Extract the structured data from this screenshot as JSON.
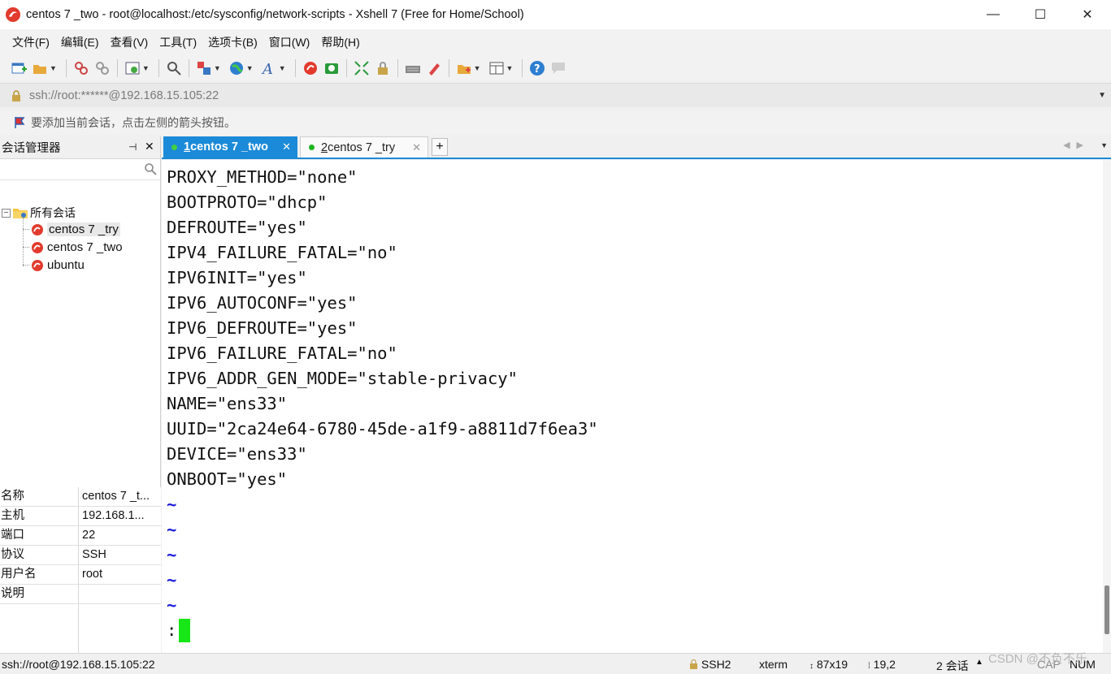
{
  "window": {
    "title": "centos 7 _two - root@localhost:/etc/sysconfig/network-scripts - Xshell 7 (Free for Home/School)",
    "controls": {
      "minimize": "—",
      "maximize": "☐",
      "close": "✕"
    }
  },
  "menu": [
    "文件(F)",
    "编辑(E)",
    "查看(V)",
    "工具(T)",
    "选项卡(B)",
    "窗口(W)",
    "帮助(H)"
  ],
  "toolbar": {
    "icons": [
      "new-session",
      "open-folder",
      "connect",
      "disconnect",
      "properties",
      "find",
      "transfer",
      "globe",
      "font",
      "xshell-logo",
      "xftp-logo",
      "fullscreen",
      "lock",
      "keyboard",
      "highlight",
      "new-tab",
      "layout",
      "help",
      "chat"
    ]
  },
  "address_bar": {
    "value": "ssh://root:******@192.168.15.105:22"
  },
  "hint": {
    "text": "要添加当前会话，点击左侧的箭头按钮。"
  },
  "sidebar": {
    "title": "会话管理器",
    "pin": "⊣",
    "close": "✕",
    "root_label": "所有会话",
    "sessions": [
      "centos 7 _try",
      "centos 7 _two",
      "ubuntu"
    ],
    "properties": [
      {
        "key": "名称",
        "value": "centos 7 _t..."
      },
      {
        "key": "主机",
        "value": "192.168.1..."
      },
      {
        "key": "端口",
        "value": "22"
      },
      {
        "key": "协议",
        "value": "SSH"
      },
      {
        "key": "用户名",
        "value": "root"
      },
      {
        "key": "说明",
        "value": ""
      }
    ]
  },
  "tabs": [
    {
      "num": "1",
      "label": " centos 7 _two",
      "close": "✕",
      "active": true
    },
    {
      "num": "2",
      "label": " centos 7 _try",
      "close": "✕",
      "active": false
    }
  ],
  "tab_add": "+",
  "terminal": {
    "lines": [
      "PROXY_METHOD=\"none\"",
      "BOOTPROTO=\"dhcp\"",
      "DEFROUTE=\"yes\"",
      "IPV4_FAILURE_FATAL=\"no\"",
      "IPV6INIT=\"yes\"",
      "IPV6_AUTOCONF=\"yes\"",
      "IPV6_DEFROUTE=\"yes\"",
      "IPV6_FAILURE_FATAL=\"no\"",
      "IPV6_ADDR_GEN_MODE=\"stable-privacy\"",
      "NAME=\"ens33\"",
      "UUID=\"2ca24e64-6780-45de-a1f9-a8811d7f6ea3\"",
      "DEVICE=\"ens33\"",
      "ONBOOT=\"yes\""
    ],
    "tildes": [
      "~",
      "~",
      "~",
      "~",
      "~"
    ],
    "prompt": ":"
  },
  "status": {
    "connection": "ssh://root@192.168.15.105:22",
    "protocol": "SSH2",
    "term_type": "xterm",
    "size": "87x19",
    "cursor_pos": "19,2",
    "sessions": "2 会话",
    "caps": "CAP",
    "num": "NUM"
  },
  "watermark": "CSDN @不负不乐",
  "colors": {
    "accent": "#1b8ad8",
    "cursor": "#17e617",
    "tilde": "#1a1adb",
    "online_dot": "#1fb51f"
  }
}
